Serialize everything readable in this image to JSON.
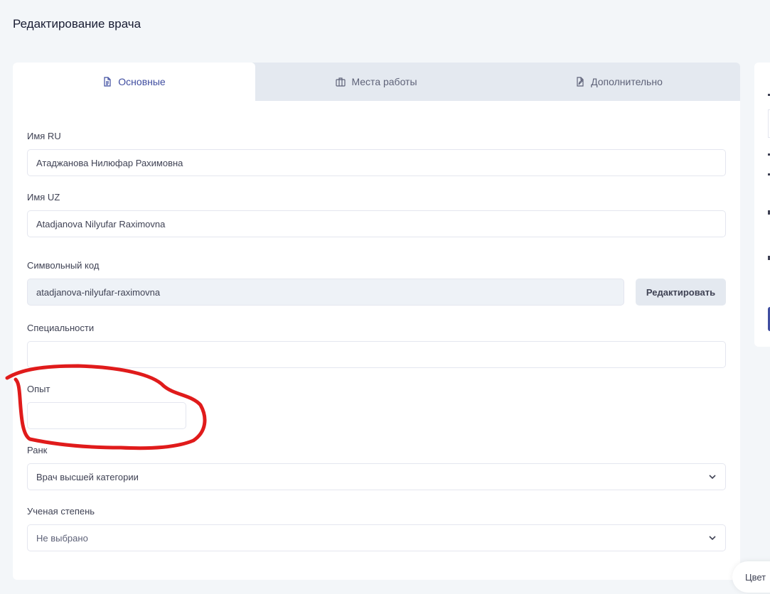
{
  "page": {
    "title": "Редактирование врача"
  },
  "tabs": [
    {
      "label": "Основные",
      "icon": "document-icon",
      "active": true
    },
    {
      "label": "Места работы",
      "icon": "briefcase-icon",
      "active": false
    },
    {
      "label": "Дополнительно",
      "icon": "document-edit-icon",
      "active": false
    }
  ],
  "form": {
    "name_ru": {
      "label": "Имя RU",
      "value": "Атаджанова Нилюфар Рахимовна"
    },
    "name_uz": {
      "label": "Имя UZ",
      "value": "Atadjanova Nilyufar Raximovna"
    },
    "slug": {
      "label": "Символьный код",
      "value": "atadjanova-nilyufar-raximovna",
      "edit_label": "Редактировать"
    },
    "specialties": {
      "label": "Специальности",
      "value": ""
    },
    "experience": {
      "label": "Опыт",
      "value": ""
    },
    "rank": {
      "label": "Ранк",
      "value": "Врач высшей категории"
    },
    "degree": {
      "label": "Ученая степень",
      "value": "Не выбрано"
    }
  },
  "widgets": {
    "color_label": "Цвет"
  },
  "colors": {
    "accent": "#3f4da0",
    "annotation": "#e01b1b",
    "background": "#f3f6f9"
  }
}
